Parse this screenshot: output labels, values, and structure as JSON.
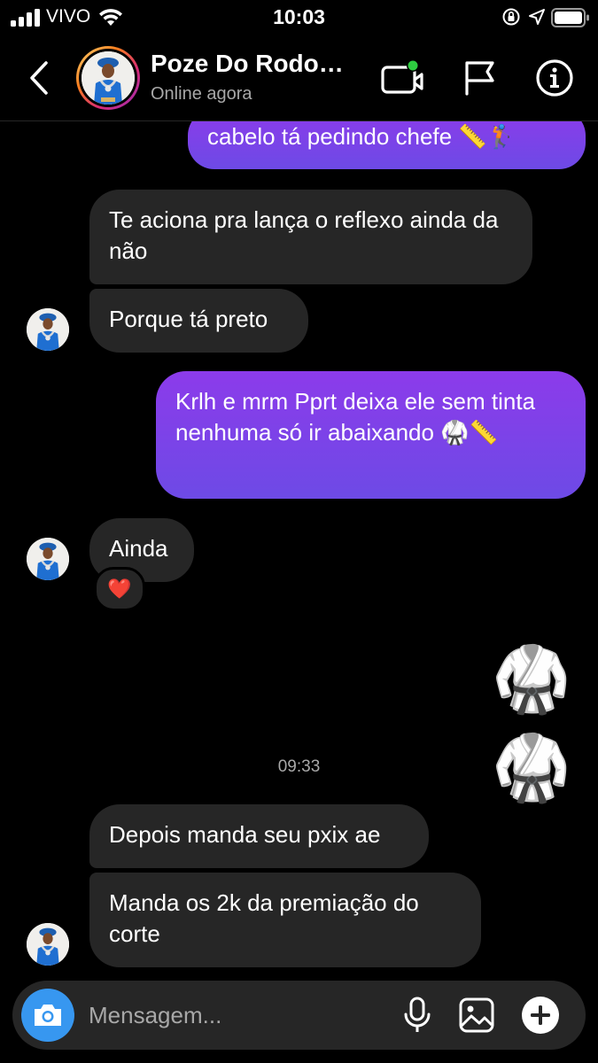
{
  "status_bar": {
    "carrier": "VIVO",
    "time": "10:03"
  },
  "header": {
    "contact_name": "Poze Do Rodo…",
    "contact_status": "Online agora",
    "icons": [
      "back-arrow-icon",
      "video-call-icon",
      "flag-icon",
      "info-icon"
    ]
  },
  "messages": [
    {
      "id": "m1",
      "direction": "outgoing",
      "text": "cabelo tá pedindo chefe 📏🏌"
    },
    {
      "id": "m2",
      "direction": "incoming",
      "text": "Te aciona pra lança o reflexo ainda da não"
    },
    {
      "id": "m3",
      "direction": "incoming",
      "text": "Porque tá preto"
    },
    {
      "id": "m4",
      "direction": "outgoing",
      "text": "Krlh e mrm Pprt deixa ele sem tinta nenhuma só ir abaixando 🥋📏"
    },
    {
      "id": "m5",
      "direction": "incoming",
      "text": "Ainda",
      "reaction": "❤️"
    },
    {
      "id": "m6",
      "direction": "outgoing",
      "text": "🥋🥋"
    },
    {
      "id": "m7",
      "direction": "incoming",
      "text": "Depois manda seu pxix ae"
    },
    {
      "id": "m8",
      "direction": "incoming",
      "text": "Manda os 2k da premiação do corte"
    }
  ],
  "timestamp": "09:33",
  "composer": {
    "placeholder": "Mensagem...",
    "icons": [
      "camera-icon",
      "microphone-icon",
      "gallery-icon",
      "plus-icon"
    ]
  },
  "colors": {
    "outgoing_bubble_top": "#8c3bea",
    "outgoing_bubble_bottom": "#6d4ae6",
    "incoming_bubble": "#262626",
    "camera_button": "#3797f0",
    "online_dot": "#2ecc40"
  }
}
